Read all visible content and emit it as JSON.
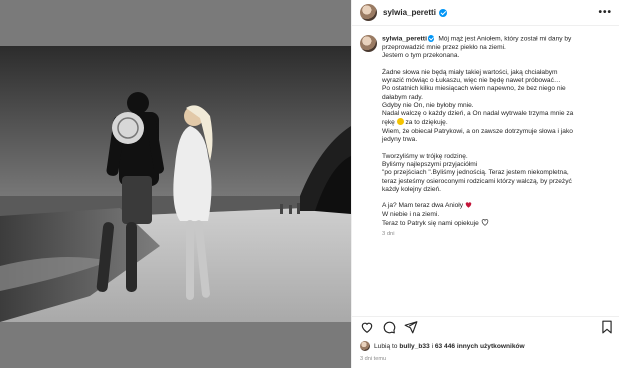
{
  "post": {
    "username": "sylwia_peretti",
    "header_username": "sylwia_peretti",
    "caption_lines": [
      "Mój mąż jest Aniołem, który został mi dany by",
      "przeprowadzić mnie przez piekło na ziemi.",
      "Jestem o tym przekonana.",
      "",
      "Żadne słowa nie będą miały takiej wartości, jaką chciałabym",
      "wyrazić mówiąc o Łukaszu, więc nie będę nawet próbować…",
      "Po ostatnich kilku miesiącach wiem napewno, że bez niego nie",
      "dałabym rady.",
      "Gdyby nie On, nie byłoby mnie.",
      "Nadal walczę o każdy dzień, a On nadal wytrwale trzyma mnie za",
      "rękę",
      "Wiem, że obiecał Patrykowi, a on zawsze dotrzymuje słowa i jako",
      "jedyny trwa.",
      "",
      "Tworzyliśmy w trójkę rodzinę.",
      "Byliśmy najlepszymi przyjaciółmi",
      "\"po przejściach \".Byliśmy jednością. Teraz jestem niekompletna,",
      "teraz jesteśmy osieroconymi rodzicami którzy walczą, by przeżyć",
      "każdy kolejny dzień.",
      "",
      "A ja? Mam teraz dwa Anioły",
      "W niebie i na ziemi.",
      "Teraz to Patryk się nami opiekuje"
    ],
    "hand_line_suffix": "za to dziękuję.",
    "caption_age": "3 dni",
    "likes": {
      "prefix": "Lubią to",
      "user": "bully_b33",
      "connector": "i",
      "count_text": "63 446 innych użytkowników"
    },
    "date": "3 dni temu",
    "icons": {
      "more": "more-horizontal-icon",
      "like": "heart-icon",
      "comment": "comment-icon",
      "share": "share-icon",
      "save": "bookmark-icon"
    },
    "colors": {
      "verified": "#0095f6",
      "heart_emoji": "#c4163a",
      "backdrop": "#7a7a7a"
    }
  }
}
